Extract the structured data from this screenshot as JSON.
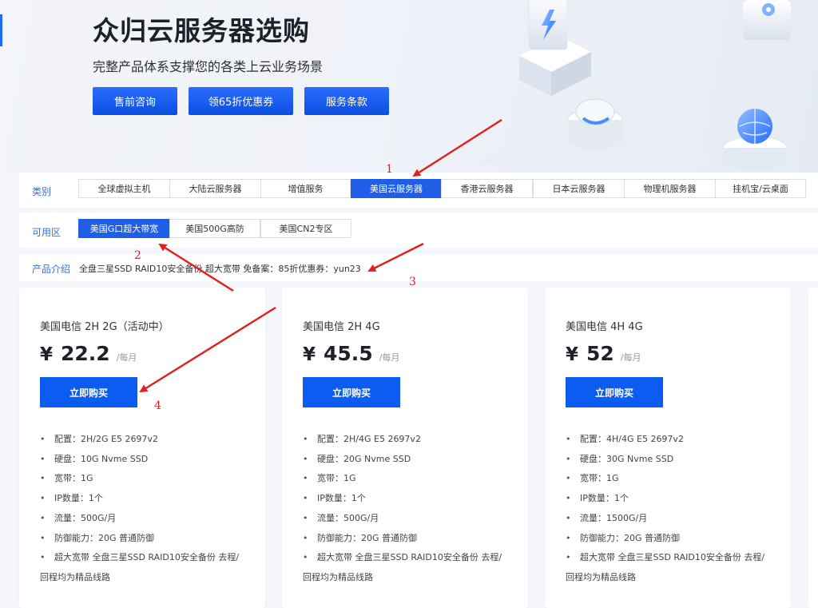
{
  "hero": {
    "title": "众归云服务器选购",
    "subtitle": "完整产品体系支撑您的各类上云业务场景",
    "buttons": [
      "售前咨询",
      "领65折优惠券",
      "服务条款"
    ]
  },
  "category": {
    "label": "类别",
    "tabs": [
      "全球虚拟主机",
      "大陆云服务器",
      "增值服务",
      "美国云服务器",
      "香港云服务器",
      "日本云服务器",
      "物理机服务器",
      "挂机宝/云桌面"
    ],
    "active": "美国云服务器"
  },
  "zone": {
    "label": "可用区",
    "tabs": [
      "美国G口超大带宽",
      "美国500G高防",
      "美国CN2专区"
    ],
    "active": "美国G口超大带宽"
  },
  "intro": {
    "label": "产品介绍",
    "text": "全盘三星SSD RAID10安全备份 超大宽带 免备案：85折优惠券：yun23"
  },
  "products": [
    {
      "title": "美国电信 2H 2G（活动中）",
      "currency": "¥",
      "price": "22.2",
      "unit": "/每月",
      "buy_label": "立即购买",
      "specs": [
        "配置：2H/2G E5 2697v2",
        "硬盘：10G Nvme SSD",
        "宽带：1G",
        "IP数量：1个",
        "流量：500G/月",
        "防御能力：20G 普通防御"
      ],
      "note_line1": "超大宽带 全盘三星SSD RAID10安全备份 去程/",
      "note_line2": "回程均为精品线路"
    },
    {
      "title": "美国电信 2H 4G",
      "currency": "¥",
      "price": "45.5",
      "unit": "/每月",
      "buy_label": "立即购买",
      "specs": [
        "配置：2H/4G E5 2697v2",
        "硬盘：20G Nvme SSD",
        "宽带：1G",
        "IP数量：1个",
        "流量：500G/月",
        "防御能力：20G 普通防御"
      ],
      "note_line1": "超大宽带 全盘三星SSD RAID10安全备份 去程/",
      "note_line2": "回程均为精品线路"
    },
    {
      "title": "美国电信 4H 4G",
      "currency": "¥",
      "price": "52",
      "unit": "/每月",
      "buy_label": "立即购买",
      "specs": [
        "配置：4H/4G E5 2697v2",
        "硬盘：30G Nvme SSD",
        "宽带：1G",
        "IP数量：1个",
        "流量：1500G/月",
        "防御能力：20G 普通防御"
      ],
      "note_line1": "超大宽带 全盘三星SSD RAID10安全备份 去程/",
      "note_line2": "回程均为精品线路"
    }
  ],
  "annotations": [
    "1",
    "2",
    "3",
    "4"
  ],
  "colors": {
    "accent": "#1f5fe8",
    "button": "#0b5cf0",
    "label": "#3b6fd6",
    "annotation": "#e0201c"
  }
}
